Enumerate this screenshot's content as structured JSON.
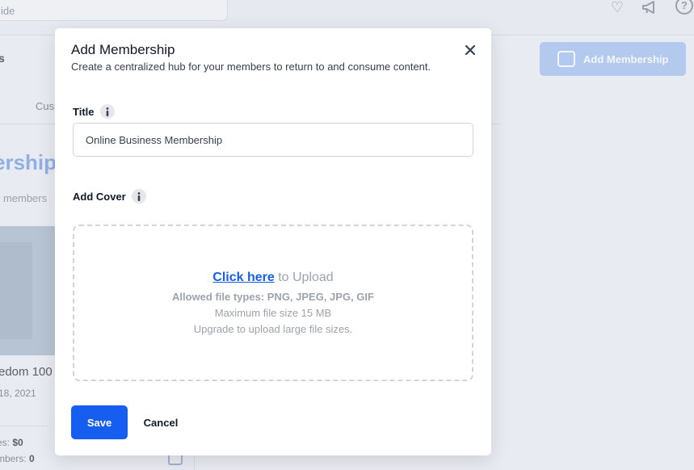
{
  "background": {
    "search_partial": "ide",
    "header_partial": "s",
    "tab_partial": "Cus",
    "title_partial": "ership",
    "subtitle_partial": "r members",
    "card_title_partial": "edom 100",
    "card_date_partial": "18, 2021",
    "stat1_label": "es: ",
    "stat1_value": "$0",
    "stat2_label": "mbers: ",
    "stat2_value": "0",
    "add_button_label": "Add Membership",
    "help_icon_glyph": "?"
  },
  "modal": {
    "title": "Add Membership",
    "description": "Create a centralized hub for your members to return to and consume content.",
    "title_field": {
      "label": "Title",
      "value": "Online Business Membership"
    },
    "cover_field": {
      "label": "Add Cover"
    },
    "upload": {
      "link_text": "Click here",
      "suffix_text": " to Upload",
      "allowed_types": "Allowed file types: PNG, JPEG, JPG, GIF",
      "max_size": "Maximum file size 15 MB",
      "upgrade_note": "Upgrade to upload large file sizes."
    },
    "save_label": "Save",
    "cancel_label": "Cancel"
  },
  "colors": {
    "primary": "#155eef",
    "overlay_background": "#e8ebf1",
    "disabled_primary": "#b3c9ee"
  }
}
